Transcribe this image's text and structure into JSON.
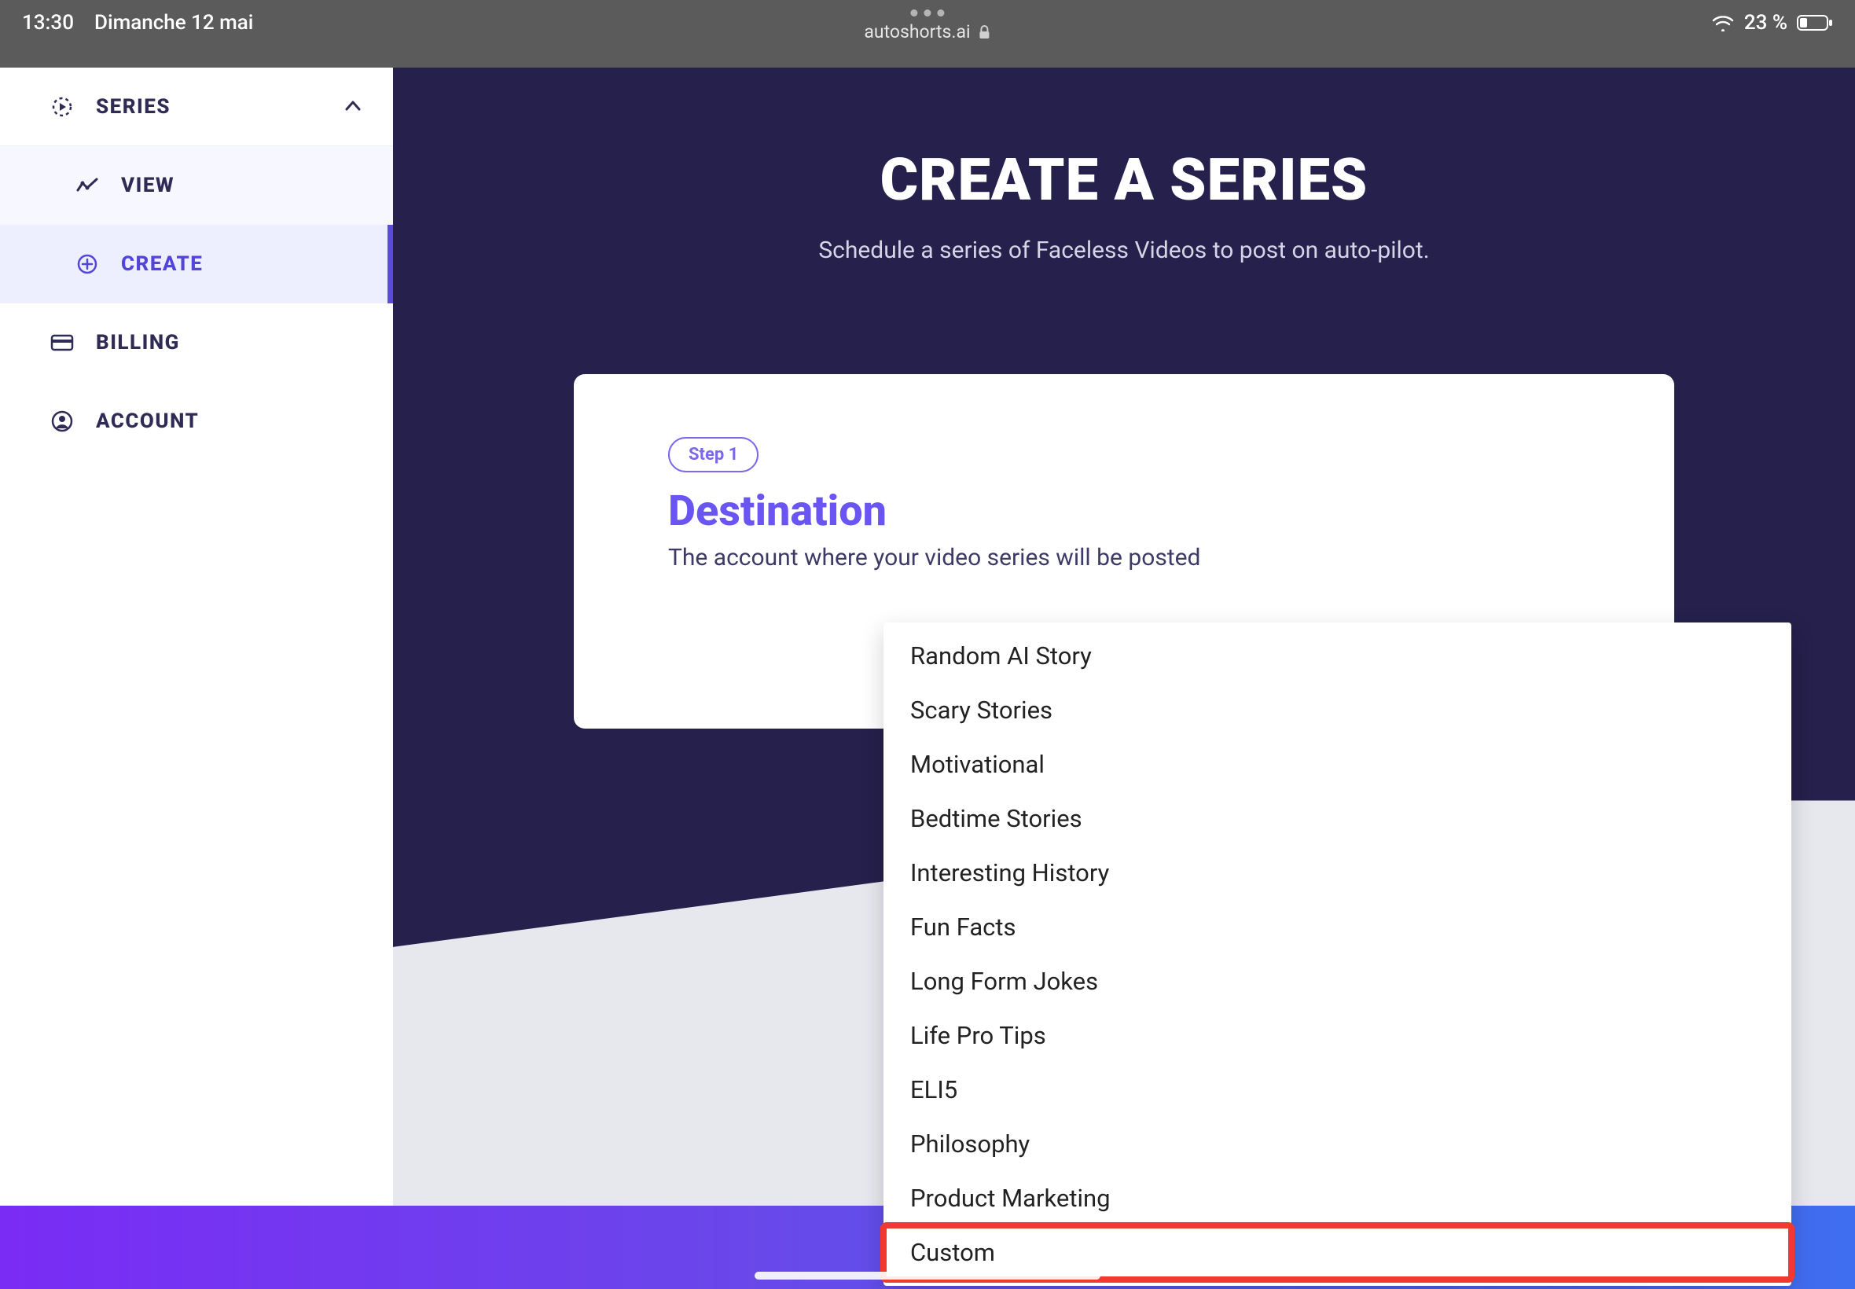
{
  "statusbar": {
    "time": "13:30",
    "date": "Dimanche 12 mai",
    "url": "autoshorts.ai",
    "battery": "23 %"
  },
  "sidebar": {
    "series_label": "SERIES",
    "view_label": "VIEW",
    "create_label": "CREATE",
    "billing_label": "BILLING",
    "account_label": "ACCOUNT"
  },
  "main": {
    "title": "CREATE A SERIES",
    "subtitle": "Schedule a series of Faceless Videos to post on auto-pilot.",
    "step_label": "Step 1",
    "section_title": "Destination",
    "section_desc": "The account where your video series will be posted"
  },
  "dropdown": {
    "items": [
      "Random AI Story",
      "Scary Stories",
      "Motivational",
      "Bedtime Stories",
      "Interesting History",
      "Fun Facts",
      "Long Form Jokes",
      "Life Pro Tips",
      "ELI5",
      "Philosophy",
      "Product Marketing",
      "Custom"
    ]
  }
}
